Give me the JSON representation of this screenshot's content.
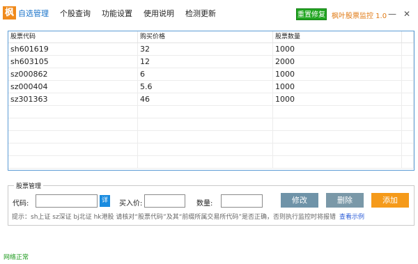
{
  "app": {
    "logo_char": "枫",
    "title": "枫叶股票监控 1.0",
    "repair_label": "重置修复"
  },
  "menu": [
    {
      "label": "自选管理",
      "active": true
    },
    {
      "label": "个股查询",
      "active": false
    },
    {
      "label": "功能设置",
      "active": false
    },
    {
      "label": "使用说明",
      "active": false
    },
    {
      "label": "检测更新",
      "active": false
    }
  ],
  "window_controls": {
    "minimize": "—",
    "close": "✕"
  },
  "table": {
    "headers": [
      "股票代码",
      "购买价格",
      "股票数量"
    ],
    "rows": [
      [
        "sh601619",
        "32",
        "1000"
      ],
      [
        "sh603105",
        "12",
        "2000"
      ],
      [
        "sz000862",
        "6",
        "1000"
      ],
      [
        "sz000404",
        "5.6",
        "1000"
      ],
      [
        "sz301363",
        "46",
        "1000"
      ]
    ]
  },
  "form": {
    "group_title": "股票管理",
    "code_label": "代码:",
    "code_value": "",
    "detail_label": "详",
    "price_label": "买入价:",
    "price_value": "",
    "qty_label": "数量:",
    "qty_value": "",
    "modify_label": "修改",
    "delete_label": "删除",
    "add_label": "添加",
    "tip_text": "提示：sh上证 sz深证 bj北证 hk港股  请核对“股票代码”及其“前缀所属交易所代码”是否正确，否则执行监控时将报错",
    "tip_link": "查看示例"
  },
  "status": {
    "text": "网络正常"
  },
  "colors": {
    "accent": "#1a73c9",
    "repair": "#21a521",
    "title_orange": "#e07a14",
    "modify_btn": "#6f93a8",
    "delete_btn": "#7a98a8",
    "add_btn": "#f59a1a",
    "status_green": "#1e9a1e"
  }
}
